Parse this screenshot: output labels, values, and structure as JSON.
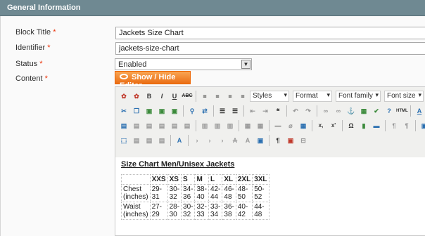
{
  "section": {
    "title": "General Information"
  },
  "fields": {
    "block_title": {
      "label": "Block Title",
      "value": "Jackets Size Chart"
    },
    "identifier": {
      "label": "Identifier",
      "value": "jackets-size-chart"
    },
    "status": {
      "label": "Status",
      "value": "Enabled"
    },
    "content": {
      "label": "Content"
    }
  },
  "required_mark": "*",
  "editor_button": {
    "label": "Show / Hide Editor"
  },
  "toolbar": {
    "styles": "Styles",
    "format": "Format",
    "font_family": "Font family",
    "font_size": "Font size",
    "bold": "B",
    "italic": "I",
    "underline": "U",
    "strike": "ABC",
    "sub": "x,",
    "sup": "x'",
    "omega": "Ω",
    "html": "HTML",
    "pilcrow": "¶"
  },
  "content": {
    "heading": "Size Chart Men/Unisex Jackets",
    "headers": [
      "",
      "XXS",
      "XS",
      "S",
      "M",
      "L",
      "XL",
      "2XL",
      "3XL"
    ],
    "rows": [
      [
        "Chest (inches)",
        "29-31",
        "30-32",
        "34-36",
        "38-40",
        "42-44",
        "46-48",
        "48-50",
        "50-52"
      ],
      [
        "Waist (inches)",
        "27-29",
        "28-30",
        "30-32",
        "32-33",
        "33-34",
        "36-38",
        "40-42",
        "44-48"
      ]
    ]
  }
}
